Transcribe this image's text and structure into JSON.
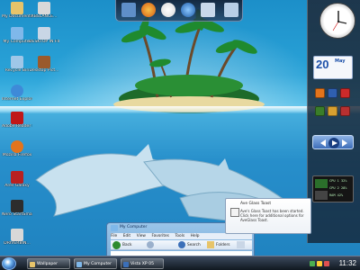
{
  "desktop_icons": [
    {
      "label": "My Documents",
      "icon": "folder-documents-icon",
      "color": "#e7c46a"
    },
    {
      "label": "XBSLANCE...",
      "icon": "shortcut-icon",
      "color": "#d9d9d9"
    },
    {
      "label": "My Computer",
      "icon": "computer-icon",
      "color": "#7fb8ea"
    },
    {
      "label": "DESKTOP IN FILE.EXE",
      "icon": "file-icon",
      "color": "#c9d6e6"
    },
    {
      "label": "Recycle Bin",
      "icon": "recycle-bin-icon",
      "color": "#9fc7e8"
    },
    {
      "label": "Desktop Pict...",
      "icon": "image-icon",
      "color": "#9a5a2c"
    },
    {
      "label": "Internet Explorer",
      "icon": "ie-icon",
      "color": "#3e8ad8"
    },
    {
      "label": "Adobe Reader 8",
      "icon": "pdf-icon",
      "color": "#c01818"
    },
    {
      "label": "Mozilla Firefox",
      "icon": "firefox-icon",
      "color": "#e3741c"
    },
    {
      "label": "Ares Galaxy",
      "icon": "ares-icon",
      "color": "#b82020"
    },
    {
      "label": "Nero StartSmart",
      "icon": "nero-icon",
      "color": "#2d2d2d"
    },
    {
      "label": "DRIVERBIN...",
      "icon": "driver-icon",
      "color": "#d8d8d8"
    }
  ],
  "dock": {
    "buttons": [
      "monitor-icon",
      "firefox-icon",
      "media-icon",
      "play-icon",
      "mail-icon",
      "trash-icon"
    ]
  },
  "sidebar": {
    "calendar_day": "20",
    "calendar_month": "May",
    "cpu_rows": [
      "CPU 1 32%",
      "CPU 2 28%",
      "RAM 42%"
    ],
    "media_buttons": [
      "prev-icon",
      "play-icon",
      "next-icon"
    ]
  },
  "window": {
    "title": "My Computer",
    "menu": [
      "File",
      "Edit",
      "View",
      "Favorites",
      "Tools",
      "Help"
    ],
    "toolbar": {
      "back": "Back",
      "search": "Search",
      "folders": "Folders"
    }
  },
  "toast": {
    "title": "Ave Glass Toast",
    "body": "Ave's Glass Toast has been started. Click here for additional options for AveGlass Toast."
  },
  "taskbar": {
    "items": [
      {
        "label": "Wallpaper",
        "icon": "folder-icon"
      },
      {
        "label": "My Computer",
        "icon": "computer-icon"
      },
      {
        "label": "Vista XP 05",
        "icon": "window-icon"
      }
    ],
    "time": "11:32"
  },
  "colors": {
    "accent": "#1e4f9a",
    "water": "#2aa3d8"
  }
}
